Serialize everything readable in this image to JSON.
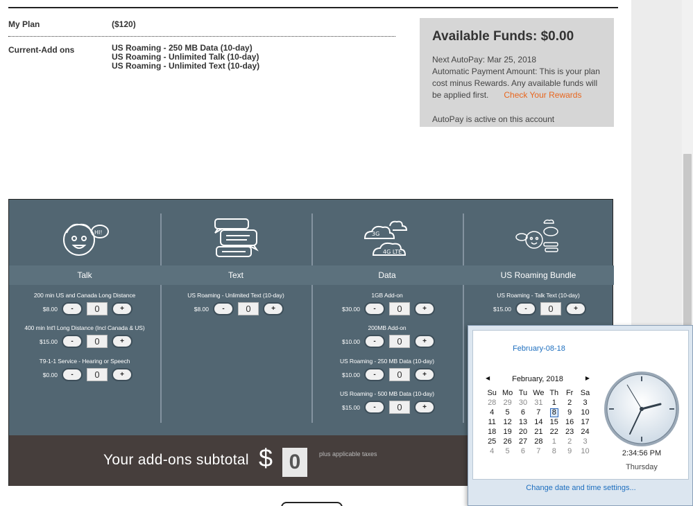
{
  "plan": {
    "label": "My Plan",
    "value": "($120)",
    "addons_label": "Current-Add ons",
    "addons": [
      "US Roaming - 250 MB Data (10-day)",
      "US Roaming - Unlimited Talk (10-day)",
      "US Roaming - Unlimited Text (10-day)"
    ]
  },
  "funds": {
    "title": "Available Funds: $0.00",
    "next_autopay": "Next AutoPay: Mar 25, 2018",
    "description": "Automatic Payment Amount: This is your plan cost minus Rewards. Any available funds will be applied first.",
    "rewards_link": "Check Your Rewards",
    "status": "AutoPay is active on this account"
  },
  "categories": [
    {
      "name": "Talk",
      "icon": "talk-icon",
      "items": [
        {
          "name": "200 min US and Canada Long Distance",
          "price": "$8.00",
          "qty": "0"
        },
        {
          "name": "400 min Int'l Long Distance (Incl Canada & US)",
          "price": "$15.00",
          "qty": "0"
        },
        {
          "name": "T9-1-1 Service - Hearing or Speech",
          "price": "$0.00",
          "qty": "0"
        }
      ]
    },
    {
      "name": "Text",
      "icon": "text-bubbles-icon",
      "items": [
        {
          "name": "US Roaming - Unlimited Text (10-day)",
          "price": "$8.00",
          "qty": "0"
        }
      ]
    },
    {
      "name": "Data",
      "icon": "data-clouds-icon",
      "items": [
        {
          "name": "1GB Add-on",
          "price": "$30.00",
          "qty": "0"
        },
        {
          "name": "200MB Add-on",
          "price": "$10.00",
          "qty": "0"
        },
        {
          "name": "US Roaming - 250 MB Data (10-day)",
          "price": "$10.00",
          "qty": "0"
        },
        {
          "name": "US Roaming - 500 MB Data (10-day)",
          "price": "$15.00",
          "qty": "0"
        }
      ]
    },
    {
      "name": "US Roaming Bundle",
      "icon": "roaming-bundle-icon",
      "items": [
        {
          "name": "US Roaming - Talk Text (10-day)",
          "price": "$15.00",
          "qty": "0"
        }
      ]
    }
  ],
  "buttons": {
    "minus": "-",
    "plus": "+"
  },
  "subtotal": {
    "label": "Your add-ons subtotal",
    "currency": "$",
    "value": "0",
    "note": "plus applicable taxes"
  },
  "datetime": {
    "date": "February-08-18",
    "month": "February, 2018",
    "weekdays": [
      "Su",
      "Mo",
      "Tu",
      "We",
      "Th",
      "Fr",
      "Sa"
    ],
    "weeks": [
      [
        "28",
        "29",
        "30",
        "31",
        "1",
        "2",
        "3"
      ],
      [
        "4",
        "5",
        "6",
        "7",
        "8",
        "9",
        "10"
      ],
      [
        "11",
        "12",
        "13",
        "14",
        "15",
        "16",
        "17"
      ],
      [
        "18",
        "19",
        "20",
        "21",
        "22",
        "23",
        "24"
      ],
      [
        "25",
        "26",
        "27",
        "28",
        "1",
        "2",
        "3"
      ],
      [
        "4",
        "5",
        "6",
        "7",
        "8",
        "9",
        "10"
      ]
    ],
    "selected_day": "8",
    "time": "2:34:56 PM",
    "weekday": "Thursday",
    "settings_link": "Change date and time settings..."
  }
}
